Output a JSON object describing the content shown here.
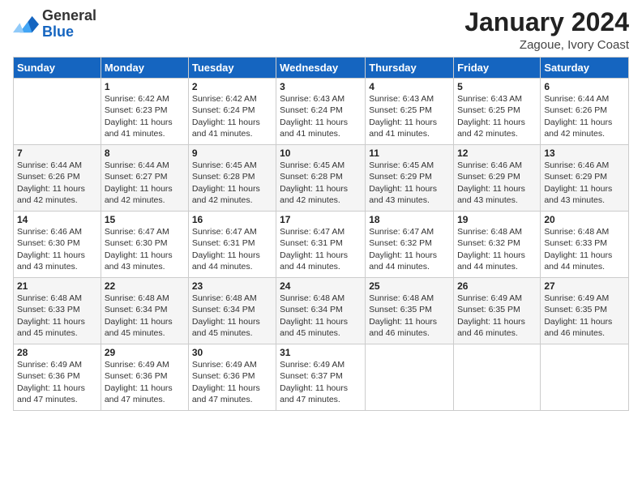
{
  "header": {
    "logo_line1": "General",
    "logo_line2": "Blue",
    "month": "January 2024",
    "location": "Zagoue, Ivory Coast"
  },
  "weekdays": [
    "Sunday",
    "Monday",
    "Tuesday",
    "Wednesday",
    "Thursday",
    "Friday",
    "Saturday"
  ],
  "weeks": [
    [
      {
        "day": "",
        "sunrise": "",
        "sunset": "",
        "daylight": ""
      },
      {
        "day": "1",
        "sunrise": "Sunrise: 6:42 AM",
        "sunset": "Sunset: 6:23 PM",
        "daylight": "Daylight: 11 hours and 41 minutes."
      },
      {
        "day": "2",
        "sunrise": "Sunrise: 6:42 AM",
        "sunset": "Sunset: 6:24 PM",
        "daylight": "Daylight: 11 hours and 41 minutes."
      },
      {
        "day": "3",
        "sunrise": "Sunrise: 6:43 AM",
        "sunset": "Sunset: 6:24 PM",
        "daylight": "Daylight: 11 hours and 41 minutes."
      },
      {
        "day": "4",
        "sunrise": "Sunrise: 6:43 AM",
        "sunset": "Sunset: 6:25 PM",
        "daylight": "Daylight: 11 hours and 41 minutes."
      },
      {
        "day": "5",
        "sunrise": "Sunrise: 6:43 AM",
        "sunset": "Sunset: 6:25 PM",
        "daylight": "Daylight: 11 hours and 42 minutes."
      },
      {
        "day": "6",
        "sunrise": "Sunrise: 6:44 AM",
        "sunset": "Sunset: 6:26 PM",
        "daylight": "Daylight: 11 hours and 42 minutes."
      }
    ],
    [
      {
        "day": "7",
        "sunrise": "Sunrise: 6:44 AM",
        "sunset": "Sunset: 6:26 PM",
        "daylight": "Daylight: 11 hours and 42 minutes."
      },
      {
        "day": "8",
        "sunrise": "Sunrise: 6:44 AM",
        "sunset": "Sunset: 6:27 PM",
        "daylight": "Daylight: 11 hours and 42 minutes."
      },
      {
        "day": "9",
        "sunrise": "Sunrise: 6:45 AM",
        "sunset": "Sunset: 6:28 PM",
        "daylight": "Daylight: 11 hours and 42 minutes."
      },
      {
        "day": "10",
        "sunrise": "Sunrise: 6:45 AM",
        "sunset": "Sunset: 6:28 PM",
        "daylight": "Daylight: 11 hours and 42 minutes."
      },
      {
        "day": "11",
        "sunrise": "Sunrise: 6:45 AM",
        "sunset": "Sunset: 6:29 PM",
        "daylight": "Daylight: 11 hours and 43 minutes."
      },
      {
        "day": "12",
        "sunrise": "Sunrise: 6:46 AM",
        "sunset": "Sunset: 6:29 PM",
        "daylight": "Daylight: 11 hours and 43 minutes."
      },
      {
        "day": "13",
        "sunrise": "Sunrise: 6:46 AM",
        "sunset": "Sunset: 6:29 PM",
        "daylight": "Daylight: 11 hours and 43 minutes."
      }
    ],
    [
      {
        "day": "14",
        "sunrise": "Sunrise: 6:46 AM",
        "sunset": "Sunset: 6:30 PM",
        "daylight": "Daylight: 11 hours and 43 minutes."
      },
      {
        "day": "15",
        "sunrise": "Sunrise: 6:47 AM",
        "sunset": "Sunset: 6:30 PM",
        "daylight": "Daylight: 11 hours and 43 minutes."
      },
      {
        "day": "16",
        "sunrise": "Sunrise: 6:47 AM",
        "sunset": "Sunset: 6:31 PM",
        "daylight": "Daylight: 11 hours and 44 minutes."
      },
      {
        "day": "17",
        "sunrise": "Sunrise: 6:47 AM",
        "sunset": "Sunset: 6:31 PM",
        "daylight": "Daylight: 11 hours and 44 minutes."
      },
      {
        "day": "18",
        "sunrise": "Sunrise: 6:47 AM",
        "sunset": "Sunset: 6:32 PM",
        "daylight": "Daylight: 11 hours and 44 minutes."
      },
      {
        "day": "19",
        "sunrise": "Sunrise: 6:48 AM",
        "sunset": "Sunset: 6:32 PM",
        "daylight": "Daylight: 11 hours and 44 minutes."
      },
      {
        "day": "20",
        "sunrise": "Sunrise: 6:48 AM",
        "sunset": "Sunset: 6:33 PM",
        "daylight": "Daylight: 11 hours and 44 minutes."
      }
    ],
    [
      {
        "day": "21",
        "sunrise": "Sunrise: 6:48 AM",
        "sunset": "Sunset: 6:33 PM",
        "daylight": "Daylight: 11 hours and 45 minutes."
      },
      {
        "day": "22",
        "sunrise": "Sunrise: 6:48 AM",
        "sunset": "Sunset: 6:34 PM",
        "daylight": "Daylight: 11 hours and 45 minutes."
      },
      {
        "day": "23",
        "sunrise": "Sunrise: 6:48 AM",
        "sunset": "Sunset: 6:34 PM",
        "daylight": "Daylight: 11 hours and 45 minutes."
      },
      {
        "day": "24",
        "sunrise": "Sunrise: 6:48 AM",
        "sunset": "Sunset: 6:34 PM",
        "daylight": "Daylight: 11 hours and 45 minutes."
      },
      {
        "day": "25",
        "sunrise": "Sunrise: 6:48 AM",
        "sunset": "Sunset: 6:35 PM",
        "daylight": "Daylight: 11 hours and 46 minutes."
      },
      {
        "day": "26",
        "sunrise": "Sunrise: 6:49 AM",
        "sunset": "Sunset: 6:35 PM",
        "daylight": "Daylight: 11 hours and 46 minutes."
      },
      {
        "day": "27",
        "sunrise": "Sunrise: 6:49 AM",
        "sunset": "Sunset: 6:35 PM",
        "daylight": "Daylight: 11 hours and 46 minutes."
      }
    ],
    [
      {
        "day": "28",
        "sunrise": "Sunrise: 6:49 AM",
        "sunset": "Sunset: 6:36 PM",
        "daylight": "Daylight: 11 hours and 47 minutes."
      },
      {
        "day": "29",
        "sunrise": "Sunrise: 6:49 AM",
        "sunset": "Sunset: 6:36 PM",
        "daylight": "Daylight: 11 hours and 47 minutes."
      },
      {
        "day": "30",
        "sunrise": "Sunrise: 6:49 AM",
        "sunset": "Sunset: 6:36 PM",
        "daylight": "Daylight: 11 hours and 47 minutes."
      },
      {
        "day": "31",
        "sunrise": "Sunrise: 6:49 AM",
        "sunset": "Sunset: 6:37 PM",
        "daylight": "Daylight: 11 hours and 47 minutes."
      },
      {
        "day": "",
        "sunrise": "",
        "sunset": "",
        "daylight": ""
      },
      {
        "day": "",
        "sunrise": "",
        "sunset": "",
        "daylight": ""
      },
      {
        "day": "",
        "sunrise": "",
        "sunset": "",
        "daylight": ""
      }
    ]
  ]
}
